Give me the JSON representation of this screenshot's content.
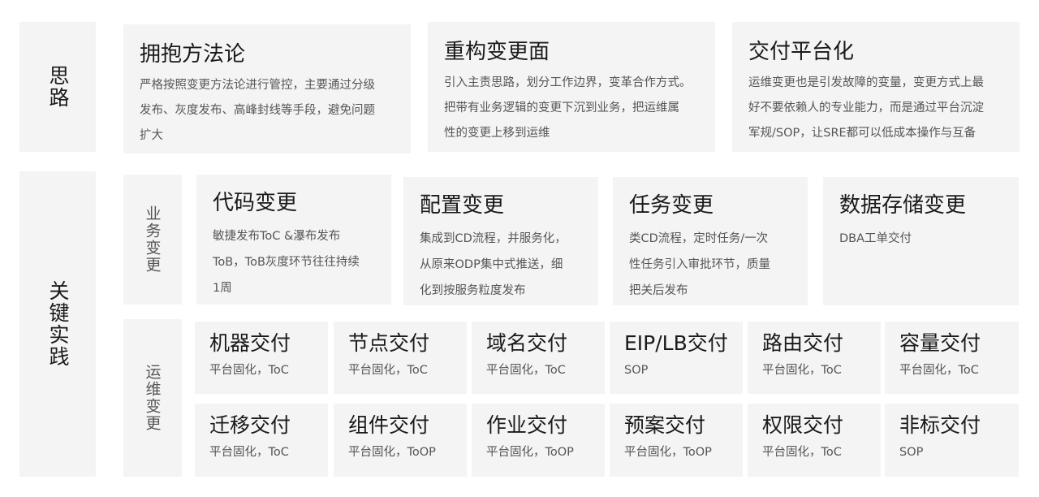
{
  "sections": {
    "thinking_label": "思路",
    "practice_label": "关键实践",
    "business_change_label": "业务变更",
    "ops_change_label": "运维变更"
  },
  "thinking_cards": [
    {
      "title": "拥抱方法论",
      "lines": [
        "严格按照变更方法论进行管控，主要通过分级",
        "发布、灰度发布、高峰封线等手段，避免问题",
        "扩大"
      ]
    },
    {
      "title": "重构变更面",
      "lines": [
        "引入主责思路，划分工作边界，变革合作方式。",
        "把带有业务逻辑的变更下沉到业务，把运维属",
        "性的变更上移到运维"
      ]
    },
    {
      "title": "交付平台化",
      "lines": [
        "运维变更也是引发故障的变量，变更方式上最",
        "好不要依赖人的专业能力，而是通过平台沉淀",
        "军规/SOP，让SRE都可以低成本操作与互备"
      ]
    }
  ],
  "business_cards": [
    {
      "title": "代码变更",
      "lines": [
        "敏捷发布ToC &瀑布发布",
        "ToB，ToB灰度环节往往持续",
        "1周"
      ]
    },
    {
      "title": "配置变更",
      "lines": [
        "集成到CD流程，并服务化，",
        "从原来ODP集中式推送，细",
        "化到按服务粒度发布"
      ]
    },
    {
      "title": "任务变更",
      "lines": [
        "类CD流程，定时任务/一次",
        "性任务引入审批环节，质量",
        "把关后发布"
      ]
    },
    {
      "title": "数据存储变更",
      "lines": [
        "DBA工单交付"
      ]
    }
  ],
  "ops_cards_row1": [
    {
      "title": "机器交付",
      "desc": "平台固化，ToC"
    },
    {
      "title": "节点交付",
      "desc": "平台固化，ToC"
    },
    {
      "title": "域名交付",
      "desc": "平台固化，ToC"
    },
    {
      "title": "EIP/LB交付",
      "desc": "SOP"
    },
    {
      "title": "路由交付",
      "desc": "平台固化，ToC"
    },
    {
      "title": "容量交付",
      "desc": "平台固化，ToC"
    }
  ],
  "ops_cards_row2": [
    {
      "title": "迁移交付",
      "desc": "平台固化，ToC"
    },
    {
      "title": "组件交付",
      "desc": "平台固化，ToOP"
    },
    {
      "title": "作业交付",
      "desc": "平台固化，ToOP"
    },
    {
      "title": "预案交付",
      "desc": "平台固化，ToOP"
    },
    {
      "title": "权限交付",
      "desc": "平台固化，ToC"
    },
    {
      "title": "非标交付",
      "desc": "SOP"
    }
  ]
}
